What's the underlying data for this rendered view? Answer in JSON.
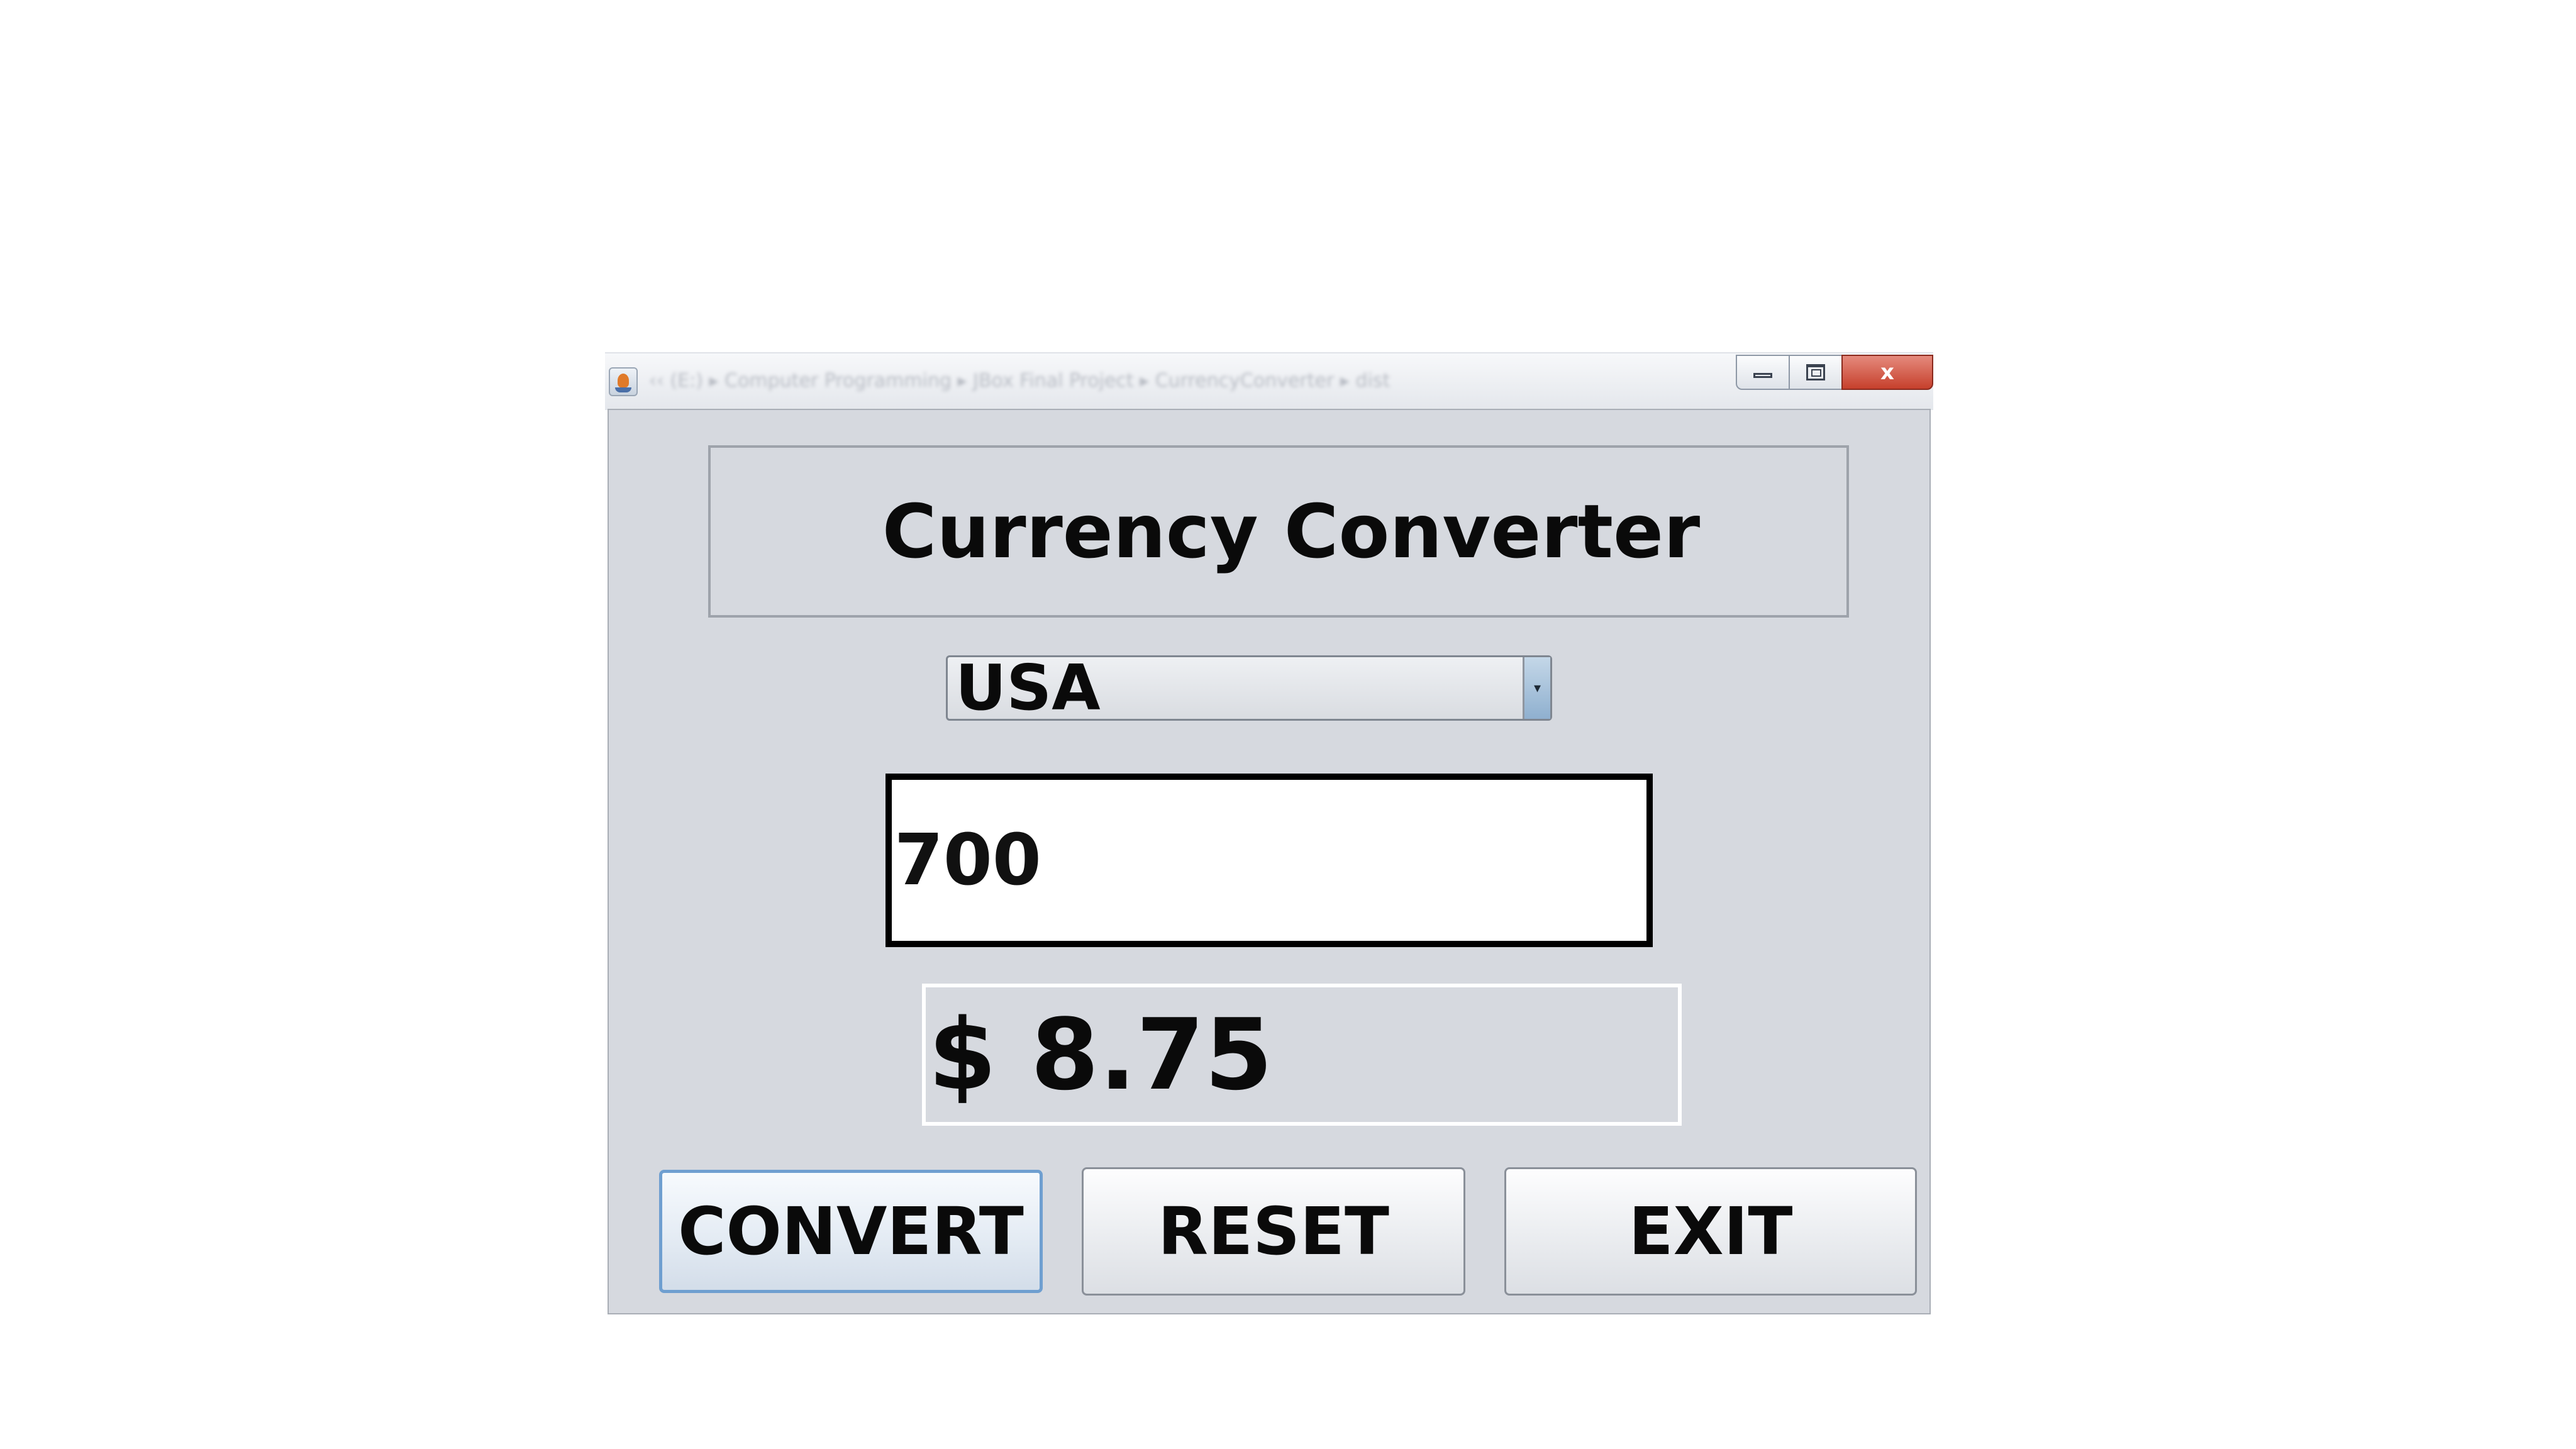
{
  "window": {
    "title": "‹‹ (E:) ▸ Computer Programming ▸ JBox Final Project ▸ CurrencyConverter ▸ dist",
    "close_glyph": "x"
  },
  "app": {
    "heading": "Currency Converter",
    "country_select": {
      "selected": "USA"
    },
    "amount_input": {
      "value": "700"
    },
    "result": "$ 8.75"
  },
  "buttons": {
    "convert": "CONVERT",
    "reset": "RESET",
    "exit": "EXIT"
  },
  "icons": {
    "app_icon": "java-cup-icon",
    "dropdown_arrow": "▾"
  },
  "colors": {
    "panel_background": "#d6d9df",
    "close_button": "#c6402c",
    "focus_border": "#6f9fd0"
  }
}
